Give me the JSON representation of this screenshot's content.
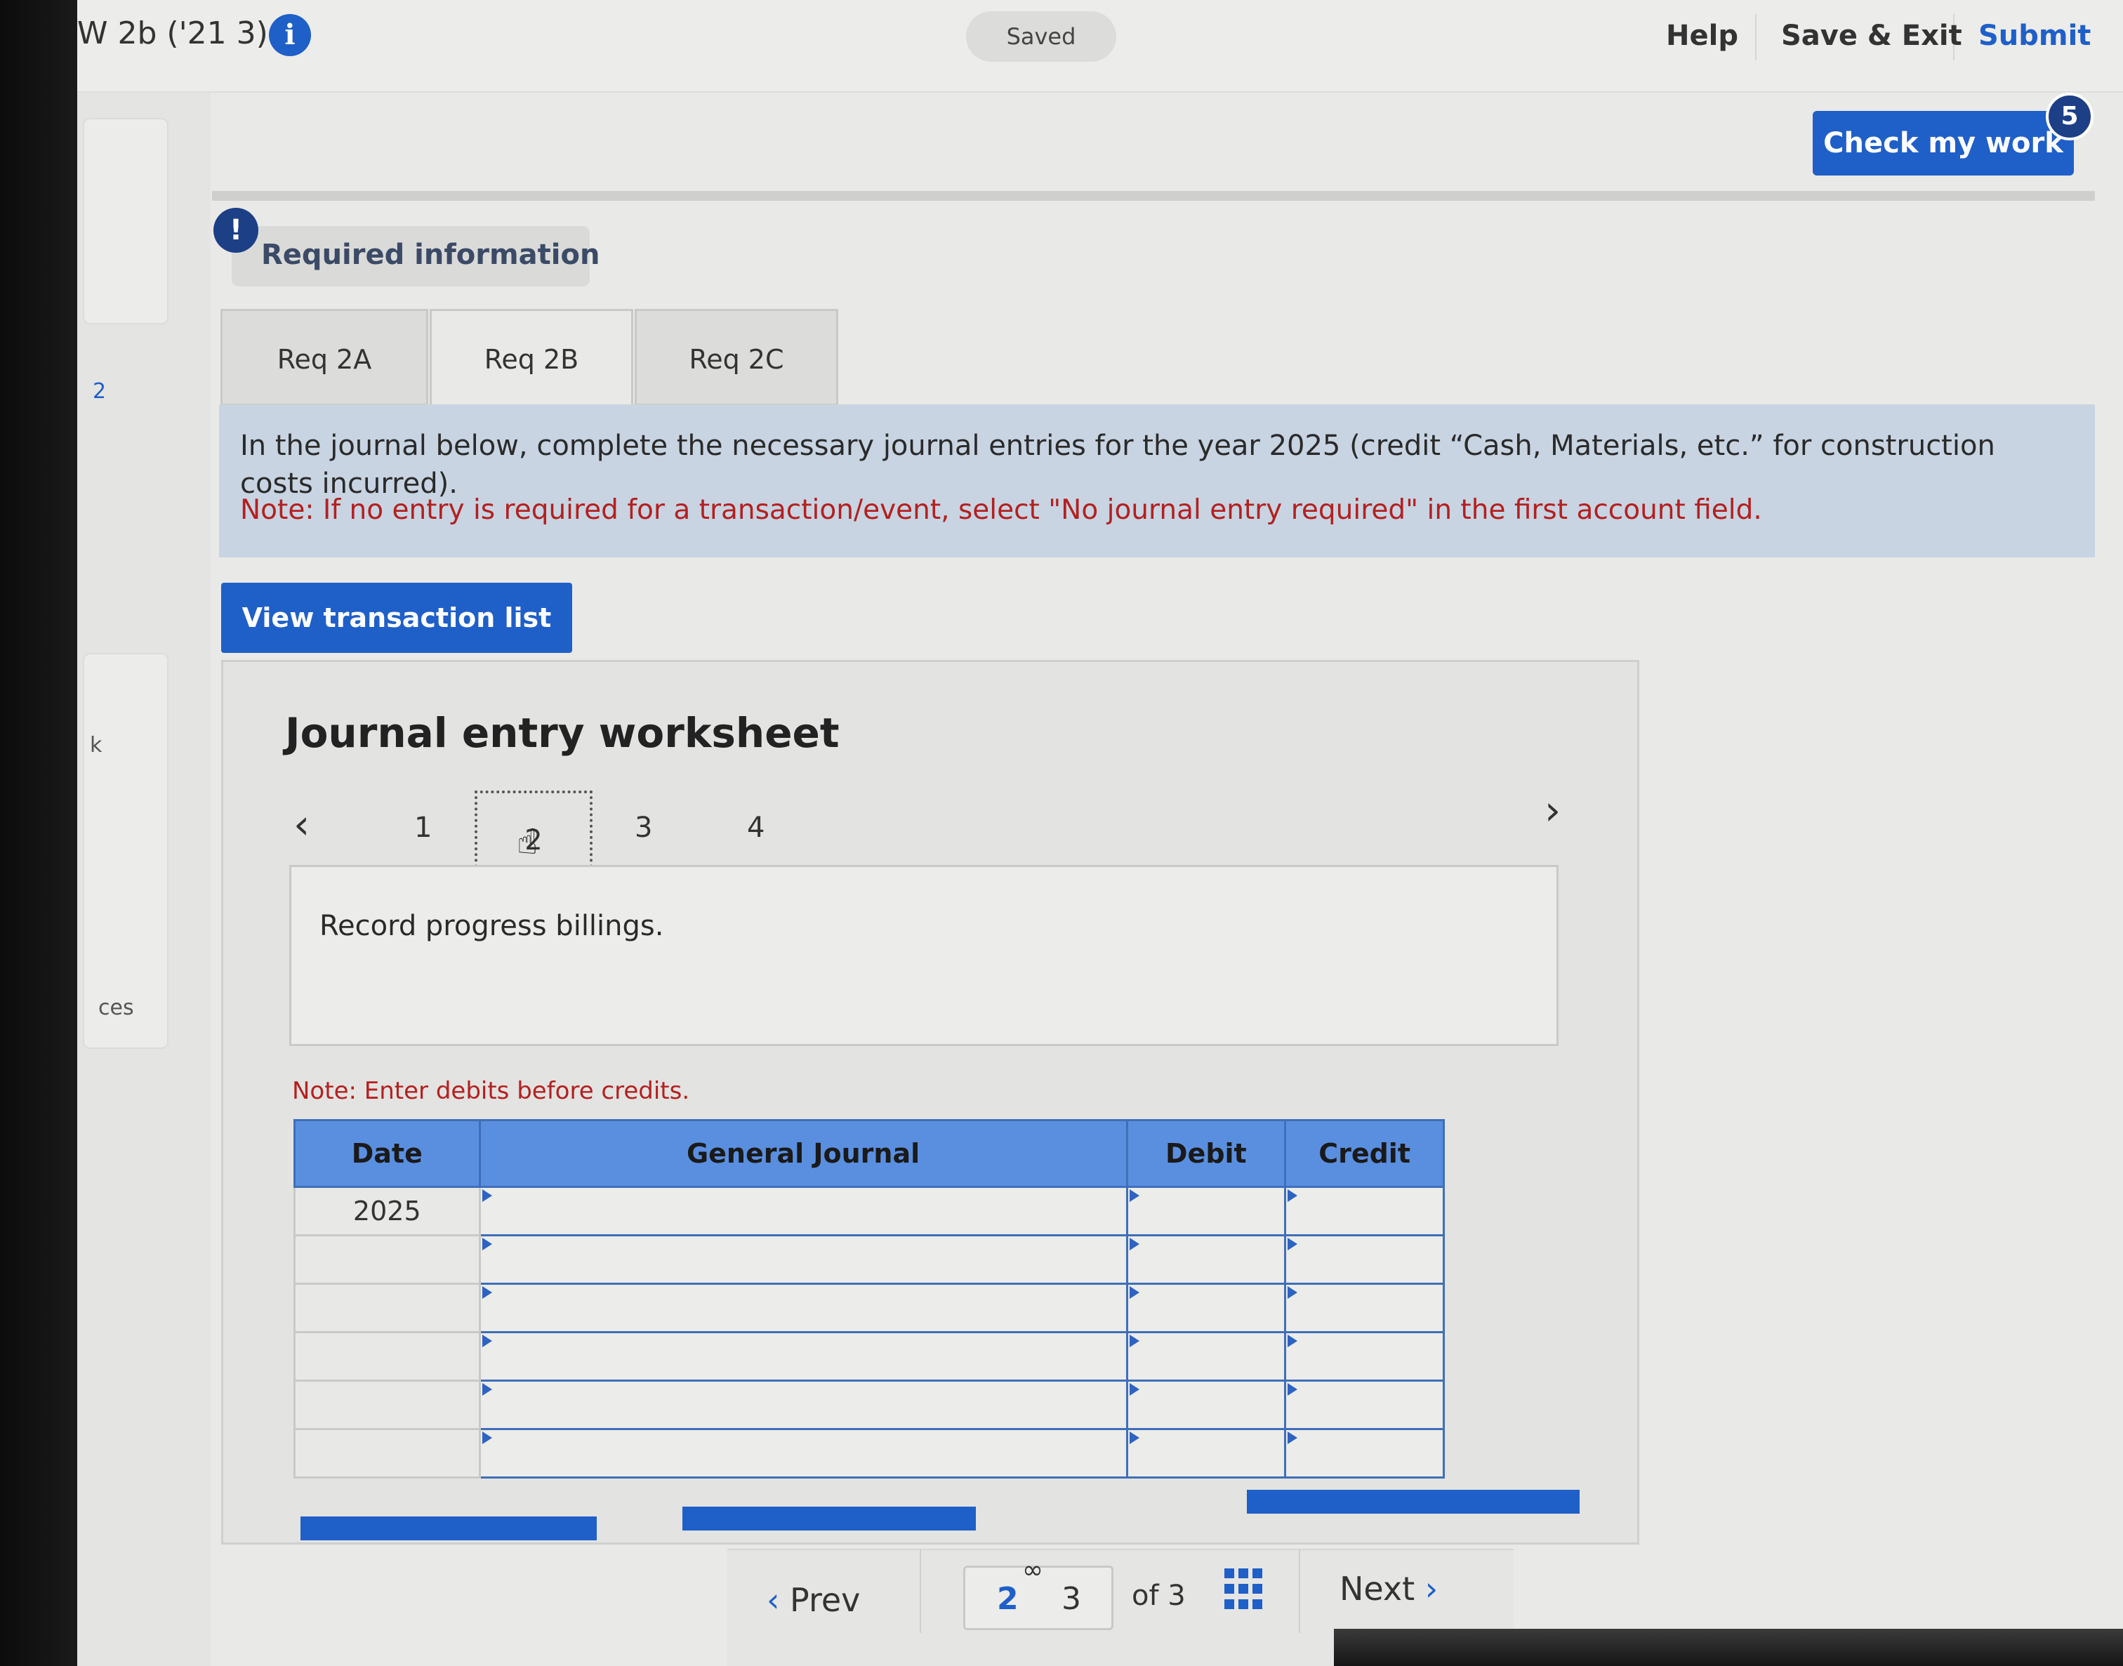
{
  "header": {
    "assignment_title": "W 2b ('21 3)",
    "saved_label": "Saved",
    "help_label": "Help",
    "save_exit_label": "Save & Exit",
    "submit_label": "Submit",
    "check_work_label": "Check my work",
    "check_work_badge": "5"
  },
  "sidebar": {
    "fragments": [
      "2",
      "k",
      "ces"
    ]
  },
  "required_info": {
    "label": "Required information"
  },
  "tabs": [
    {
      "label": "Req 2A",
      "active": false
    },
    {
      "label": "Req 2B",
      "active": true
    },
    {
      "label": "Req 2C",
      "active": false
    }
  ],
  "instructions": {
    "text": "In the journal below, complete the necessary journal entries for the year 2025 (credit “Cash, Materials, etc.” for construction costs incurred).",
    "note": "Note: If no entry is required for a transaction/event, select \"No journal entry required\" in the first account field."
  },
  "view_transaction_label": "View transaction list",
  "worksheet": {
    "title": "Journal entry worksheet",
    "pages": [
      "1",
      "2",
      "3",
      "4"
    ],
    "active_page": "2",
    "prompt": "Record progress billings.",
    "debit_note": "Note: Enter debits before credits.",
    "columns": [
      "Date",
      "General Journal",
      "Debit",
      "Credit"
    ],
    "rows": [
      {
        "date": "2025",
        "account": "",
        "debit": "",
        "credit": ""
      },
      {
        "date": "",
        "account": "",
        "debit": "",
        "credit": ""
      },
      {
        "date": "",
        "account": "",
        "debit": "",
        "credit": ""
      },
      {
        "date": "",
        "account": "",
        "debit": "",
        "credit": ""
      },
      {
        "date": "",
        "account": "",
        "debit": "",
        "credit": ""
      },
      {
        "date": "",
        "account": "",
        "debit": "",
        "credit": ""
      }
    ]
  },
  "footer": {
    "prev_label": "Prev",
    "current_page": "2",
    "typed_page": "3",
    "of_label": "of 3",
    "next_label": "Next"
  },
  "colors": {
    "accent": "#1f5fc8",
    "table_header": "#5a8fe0",
    "note_red": "#b32020",
    "instruction_bg": "#c8d4e2"
  }
}
